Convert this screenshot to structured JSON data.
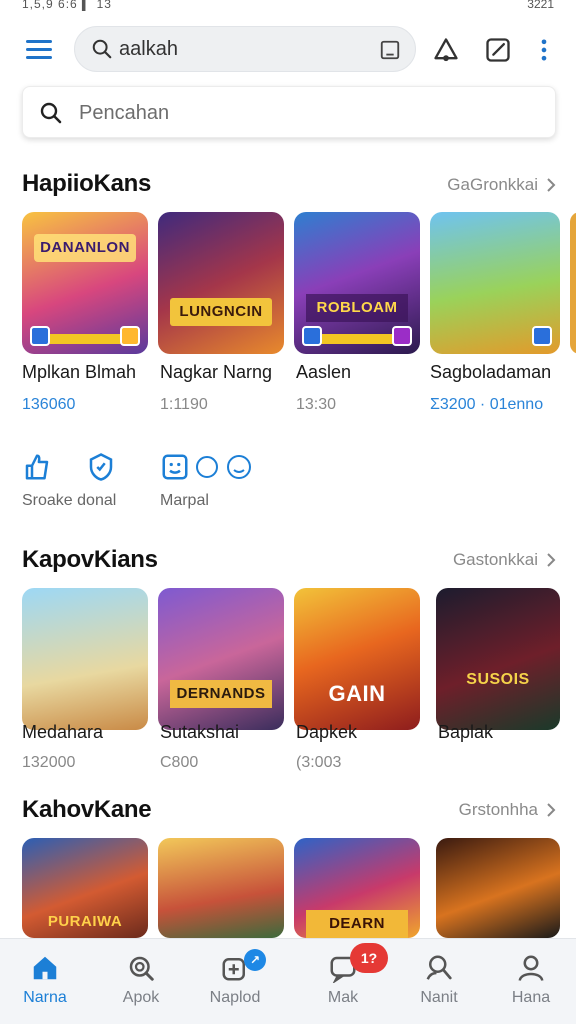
{
  "status_bar": {
    "left": "1,5,9 6:6 ▍ 13",
    "right": "3221"
  },
  "search": {
    "query": "aalkah",
    "placeholder": "Pencahan"
  },
  "sections": [
    {
      "title": "HapiioKans",
      "more": "GaGronkkai",
      "tiles": [
        {
          "name": "Mplkan Blmah",
          "sub": "136060",
          "banner": "DANANLON"
        },
        {
          "name": "Nagkar Narng",
          "sub": "1:1190",
          "banner": "LUNGNCIN"
        },
        {
          "name": "Aaslen",
          "sub": "13:30",
          "banner": "ROBLOAM"
        },
        {
          "name": "Sagboladaman",
          "sub": "Ʃ3200 · 01enno",
          "banner": ""
        }
      ]
    },
    {
      "title": "KapovKians",
      "more": "Gastonkkai",
      "tiles": [
        {
          "name": "Medahara",
          "sub": "132000",
          "banner": ""
        },
        {
          "name": "Sutakshai",
          "sub": "C800",
          "banner": "DERNANDS"
        },
        {
          "name": "Dapkek",
          "sub": "(3:003",
          "banner": "GAIN"
        },
        {
          "name": "Baplak",
          "sub": "",
          "banner": "SUSOIS"
        }
      ]
    },
    {
      "title": "KahovKane",
      "more": "Grstonhha",
      "tiles": [
        {
          "name": "",
          "sub": "",
          "banner": "PURAIWA"
        },
        {
          "name": "",
          "sub": "",
          "banner": ""
        },
        {
          "name": "",
          "sub": "",
          "banner": "DEARN"
        },
        {
          "name": "",
          "sub": "",
          "banner": ""
        }
      ]
    }
  ],
  "quick_actions": [
    {
      "label": "Sroake donal",
      "icon": "thumb-icon"
    },
    {
      "label": "",
      "icon": "shield-icon"
    },
    {
      "label": "Marpal",
      "icon": "smile-icon"
    }
  ],
  "bottom_nav": [
    {
      "label": "Narna",
      "icon": "home-icon",
      "active": true
    },
    {
      "label": "Apok",
      "icon": "search-zoom-icon",
      "active": false
    },
    {
      "label": "Naplod",
      "icon": "download-icon",
      "active": false
    },
    {
      "label": "Mak",
      "icon": "chat-icon",
      "active": false
    },
    {
      "label": "Nanit",
      "icon": "person-search-icon",
      "active": false
    },
    {
      "label": "Hana",
      "icon": "profile-icon",
      "active": false
    }
  ],
  "badges": {
    "mak": "1?"
  },
  "colors": {
    "accent": "#1c7fd6",
    "badge_blue": "#1e88e5",
    "badge_red": "#e53935",
    "muted": "#8a8a8a"
  }
}
